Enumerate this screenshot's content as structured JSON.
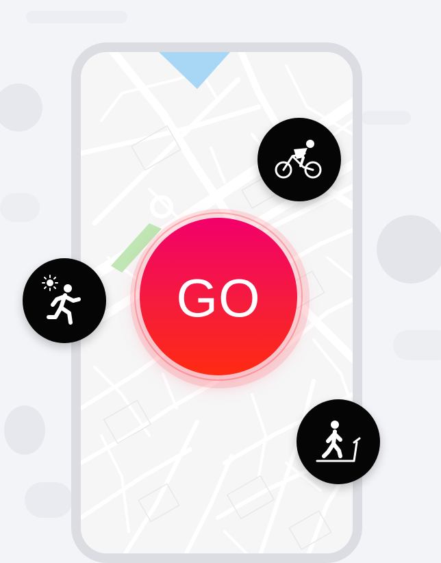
{
  "go_button": {
    "label": "GO",
    "color": "#f51c3c"
  },
  "activities": [
    {
      "name": "cycling",
      "icon": "cyclist-icon"
    },
    {
      "name": "outdoor-running",
      "icon": "runner-sun-icon"
    },
    {
      "name": "treadmill-walking",
      "icon": "treadmill-walker-icon"
    }
  ],
  "map": {
    "location_marker_color": "#a8d7f5",
    "park_color": "#bfe6b4",
    "road_color": "#ffffff",
    "block_color": "#f6f6f7"
  },
  "colors": {
    "activity_bubble": "#050505",
    "phone_frame": "#dcdde2",
    "background": "#f3f4f8"
  }
}
